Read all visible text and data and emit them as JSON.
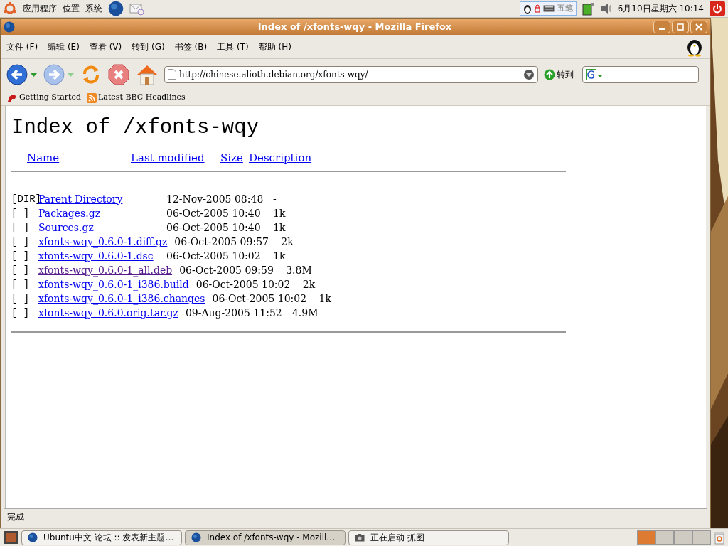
{
  "top_panel": {
    "menus": [
      "应用程序",
      "位置",
      "系统"
    ],
    "input_method": "五笔",
    "clock": "6月10日星期六 10:14"
  },
  "window": {
    "title": "Index of /xfonts-wqy - Mozilla Firefox"
  },
  "menubar": [
    "文件 (F)",
    "编辑 (E)",
    "查看 (V)",
    "转到 (G)",
    "书签 (B)",
    "工具 (T)",
    "帮助 (H)"
  ],
  "toolbar": {
    "url": "http://chinese.alioth.debian.org/xfonts-wqy/",
    "go_label": "转到"
  },
  "bookmarks": [
    "Getting Started",
    "Latest BBC Headlines"
  ],
  "page": {
    "heading": "Index of /xfonts-wqy",
    "columns": [
      "Name",
      "Last modified",
      "Size",
      "Description"
    ],
    "rows": [
      {
        "icon": "[DIR]",
        "name": "Parent Directory",
        "visited": false,
        "modified": "12-Nov-2005 08:48",
        "size": "-"
      },
      {
        "icon": "[ ]",
        "name": "Packages.gz",
        "visited": false,
        "modified": "06-Oct-2005 10:40",
        "size": "1k"
      },
      {
        "icon": "[ ]",
        "name": "Sources.gz",
        "visited": false,
        "modified": "06-Oct-2005 10:40",
        "size": "1k"
      },
      {
        "icon": "[ ]",
        "name": "xfonts-wqy_0.6.0-1.diff.gz",
        "visited": false,
        "modified": "06-Oct-2005 09:57",
        "size": "2k"
      },
      {
        "icon": "[ ]",
        "name": "xfonts-wqy_0.6.0-1.dsc",
        "visited": false,
        "modified": "06-Oct-2005 10:02",
        "size": "1k"
      },
      {
        "icon": "[ ]",
        "name": "xfonts-wqy_0.6.0-1_all.deb",
        "visited": true,
        "modified": "06-Oct-2005 09:59",
        "size": "3.8M"
      },
      {
        "icon": "[ ]",
        "name": "xfonts-wqy_0.6.0-1_i386.build",
        "visited": false,
        "modified": "06-Oct-2005 10:02",
        "size": "2k"
      },
      {
        "icon": "[ ]",
        "name": "xfonts-wqy_0.6.0-1_i386.changes",
        "visited": false,
        "modified": "06-Oct-2005 10:02",
        "size": "1k"
      },
      {
        "icon": "[ ]",
        "name": "xfonts-wqy_0.6.0.orig.tar.gz",
        "visited": false,
        "modified": "09-Aug-2005 11:52",
        "size": "4.9M"
      }
    ]
  },
  "status_bar": "完成",
  "taskbar": {
    "items": [
      {
        "label": "Ubuntu中文 论坛 :: 发表新主题…",
        "kind": "browser",
        "selected": false
      },
      {
        "label": "Index of /xfonts-wqy - Mozill…",
        "kind": "browser",
        "selected": true
      },
      {
        "label": "正在启动 抓图",
        "kind": "camera",
        "selected": false
      }
    ],
    "workspaces": [
      {
        "selected": true
      },
      {
        "selected": false
      },
      {
        "selected": false
      },
      {
        "selected": false
      }
    ]
  }
}
